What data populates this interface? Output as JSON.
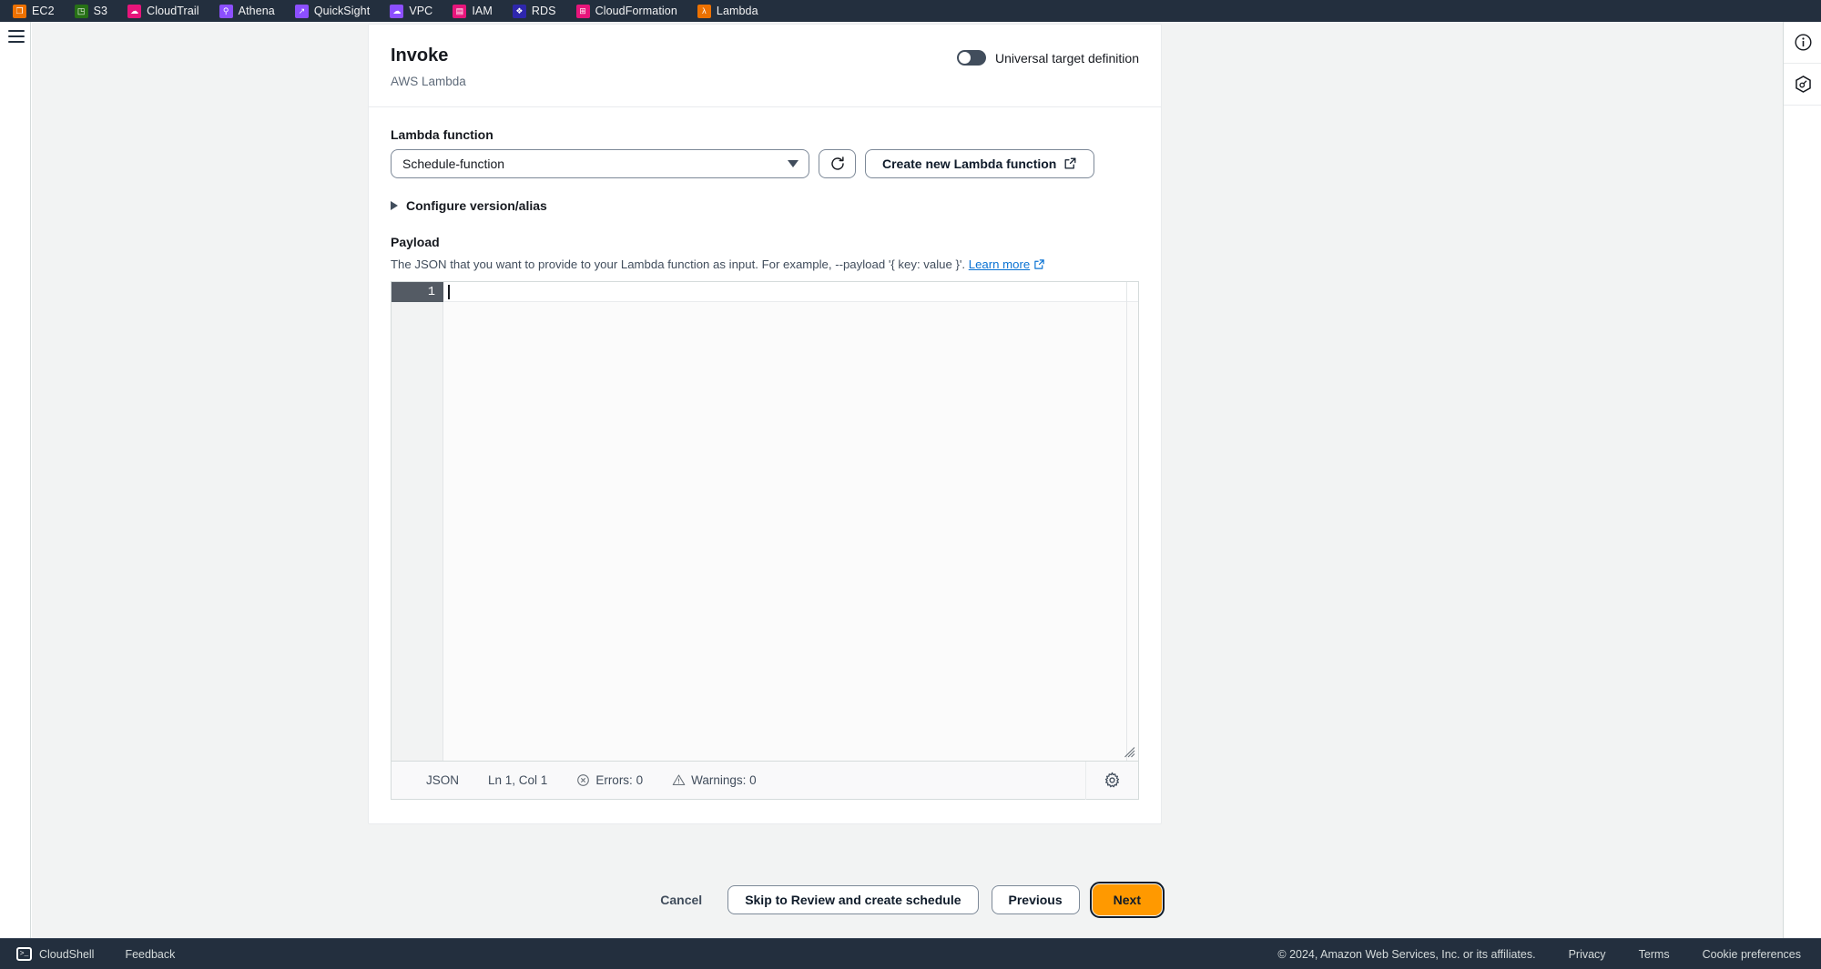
{
  "browser_bookmarks": [
    {
      "label": "EC2",
      "icon": "ec2-icon",
      "color": "#ed7100",
      "glyph": "❐"
    },
    {
      "label": "S3",
      "icon": "s3-icon",
      "color": "#277116",
      "glyph": "◳"
    },
    {
      "label": "CloudTrail",
      "icon": "cloudtrail-icon",
      "color": "#e7157b",
      "glyph": "☁"
    },
    {
      "label": "Athena",
      "icon": "athena-icon",
      "color": "#8c4fff",
      "glyph": "⚲"
    },
    {
      "label": "QuickSight",
      "icon": "quicksight-icon",
      "color": "#8c4fff",
      "glyph": "↗"
    },
    {
      "label": "VPC",
      "icon": "vpc-icon",
      "color": "#8c4fff",
      "glyph": "☁"
    },
    {
      "label": "IAM",
      "icon": "iam-icon",
      "color": "#e7157b",
      "glyph": "▤"
    },
    {
      "label": "RDS",
      "icon": "rds-icon",
      "color": "#2e27ad",
      "glyph": "❖"
    },
    {
      "label": "CloudFormation",
      "icon": "cloudformation-icon",
      "color": "#e7157b",
      "glyph": "⊞"
    },
    {
      "label": "Lambda",
      "icon": "lambda-icon",
      "color": "#ed7100",
      "glyph": "λ"
    }
  ],
  "header": {
    "title": "Invoke",
    "subtitle": "AWS Lambda",
    "toggle_label": "Universal target definition",
    "toggle_state": "off"
  },
  "form": {
    "lambda_function_label": "Lambda function",
    "lambda_function_value": "Schedule-function",
    "refresh_icon": "refresh-icon",
    "create_function_label": "Create new Lambda function",
    "external_link_icon": "external-link-icon",
    "configure_version_label": "Configure version/alias",
    "payload_label": "Payload",
    "payload_description": "The JSON that you want to provide to your Lambda function as input. For example, --payload '{ key: value }'.",
    "learn_more_label": "Learn more",
    "payload_value": ""
  },
  "editor": {
    "line_number": "1",
    "status": {
      "language": "JSON",
      "cursor_position": "Ln 1, Col 1",
      "errors": "Errors: 0",
      "warnings": "Warnings: 0",
      "errors_icon": "error-circle-icon",
      "warnings_icon": "warning-triangle-icon",
      "settings_icon": "gear-icon"
    }
  },
  "actions": {
    "cancel": "Cancel",
    "skip": "Skip to Review and create schedule",
    "previous": "Previous",
    "next": "Next",
    "next_color": "#ff9900"
  },
  "right_rail": [
    {
      "icon": "info-icon",
      "name": "info-panel-button"
    },
    {
      "icon": "settings-hex-icon",
      "name": "settings-panel-button"
    }
  ],
  "bottom_bar": {
    "cloudshell": "CloudShell",
    "feedback": "Feedback",
    "copyright": "© 2024, Amazon Web Services, Inc. or its affiliates.",
    "privacy": "Privacy",
    "terms": "Terms",
    "cookie_preferences": "Cookie preferences"
  }
}
